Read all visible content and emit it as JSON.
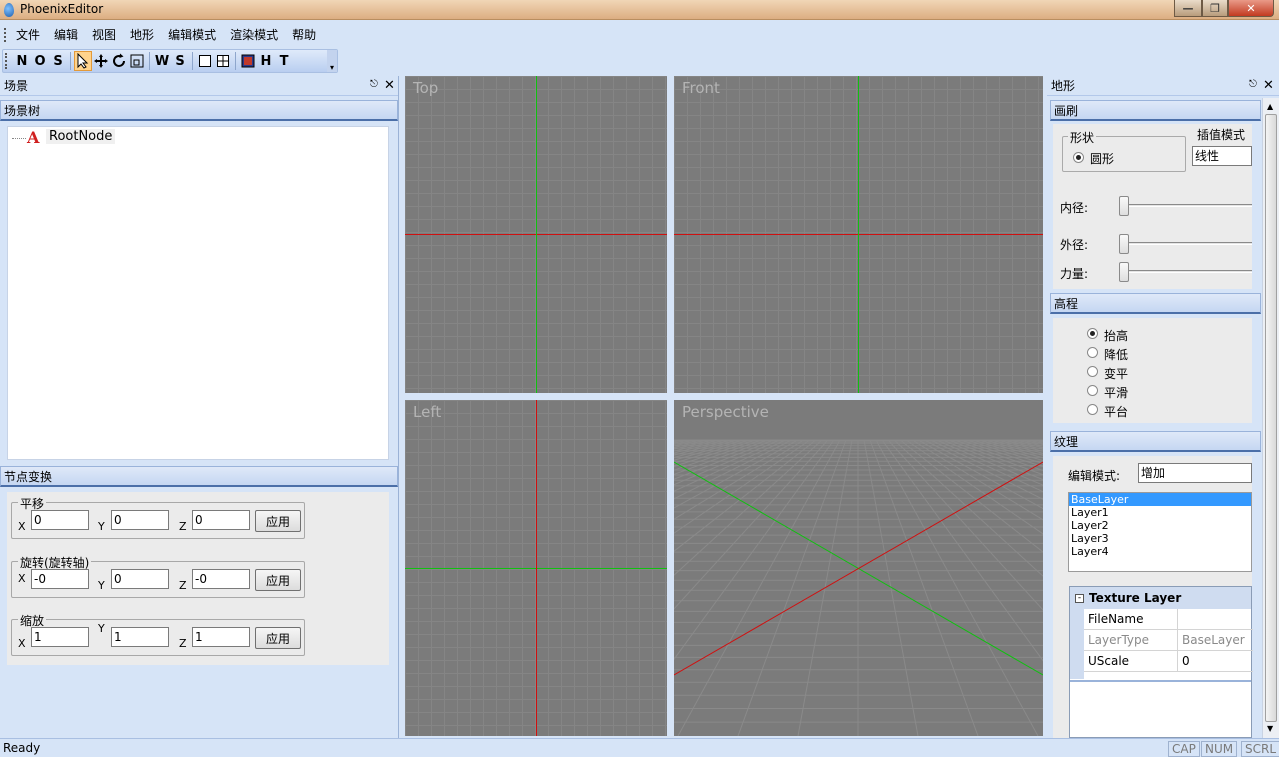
{
  "window": {
    "title": "PhoenixEditor"
  },
  "menu": [
    "文件",
    "编辑",
    "视图",
    "地形",
    "编辑模式",
    "渲染模式",
    "帮助"
  ],
  "toolbar": {
    "buttons": [
      "N",
      "O",
      "S",
      "select",
      "move",
      "rotate",
      "scale",
      "W",
      "S",
      "single-view",
      "quad-view",
      "render",
      "H",
      "T"
    ]
  },
  "left_panel": {
    "caption": "场景",
    "tree_section": "场景树",
    "tree": [
      {
        "label": "RootNode"
      }
    ],
    "transform_section": "节点变换",
    "groups": {
      "translate": {
        "label": "平移",
        "x": "0",
        "y": "0",
        "z": "0"
      },
      "rotate": {
        "label": "旋转(旋转轴)",
        "x": "-0",
        "y": "0",
        "z": "-0"
      },
      "scale": {
        "label": "缩放",
        "x": "1",
        "y": "1",
        "z": "1"
      }
    },
    "axis_x": "X",
    "axis_y": "Y",
    "axis_z": "Z",
    "apply": "应用"
  },
  "viewports": {
    "top": "Top",
    "front": "Front",
    "left": "Left",
    "perspective": "Perspective"
  },
  "right_panel": {
    "caption": "地形",
    "brush_section": "画刷",
    "shape_label": "形状",
    "shape_option": "圆形",
    "interp_label": "插值模式",
    "interp_value": "线性",
    "inner_radius": "内径:",
    "outer_radius": "外径:",
    "strength": "力量:",
    "height_section": "高程",
    "height_options": [
      "抬高",
      "降低",
      "变平",
      "平滑",
      "平台"
    ],
    "height_selected": 0,
    "texture_section": "纹理",
    "edit_mode_label": "编辑模式:",
    "edit_mode_value": "增加",
    "layers": [
      "BaseLayer",
      "Layer1",
      "Layer2",
      "Layer3",
      "Layer4"
    ],
    "layers_selected": 0,
    "property_grid": {
      "category": "Texture Layer",
      "rows": [
        {
          "key": "FileName",
          "value": ""
        },
        {
          "key": "LayerType",
          "value": "BaseLayer"
        },
        {
          "key": "UScale",
          "value": "0"
        }
      ]
    }
  },
  "status": {
    "text": "Ready",
    "cap": "CAP",
    "num": "NUM",
    "scrl": "SCRL"
  }
}
